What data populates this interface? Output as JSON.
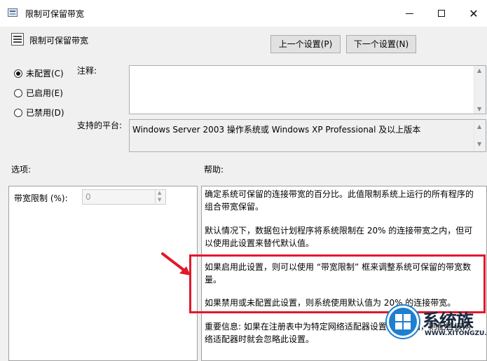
{
  "window": {
    "title": "限制可保留带宽",
    "minimize_glyph": "",
    "close_glyph": "✕"
  },
  "header": {
    "policy_name": "限制可保留带宽",
    "prev_button": "上一个设置(P)",
    "next_button": "下一个设置(N)"
  },
  "state": {
    "options": [
      {
        "label": "未配置(C)",
        "checked": true
      },
      {
        "label": "已启用(E)",
        "checked": false
      },
      {
        "label": "已禁用(D)",
        "checked": false
      }
    ]
  },
  "comment": {
    "label": "注释:",
    "value": ""
  },
  "platform": {
    "label": "支持的平台:",
    "value": "Windows Server 2003 操作系统或 Windows XP Professional 及以上版本"
  },
  "options_section": {
    "label": "选项:",
    "bandwidth_label": "带宽限制 (%):",
    "bandwidth_value": "0"
  },
  "help_section": {
    "label": "帮助:",
    "paragraphs": [
      "确定系统可保留的连接带宽的百分比。此值限制系统上运行的所有程序的组合带宽保留。",
      "默认情况下，数据包计划程序将系统限制在 20% 的连接带宽之内，但可以使用此设置来替代默认值。",
      "如果启用此设置，则可以使用 “带宽限制” 框来调整系统可保留的带宽数量。",
      "如果禁用或未配置此设置，则系统使用默认值为 20% 的连接带宽。",
      "重要信息: 如果在注册表中为特定网络适配器设置带宽限制，则配置该网络适配器时就会忽略此设置。"
    ]
  },
  "annotation": {
    "highlight_color": "#e0192b"
  },
  "watermark": {
    "text": "系统族",
    "url": "WWW.XITONGZU.COM"
  }
}
